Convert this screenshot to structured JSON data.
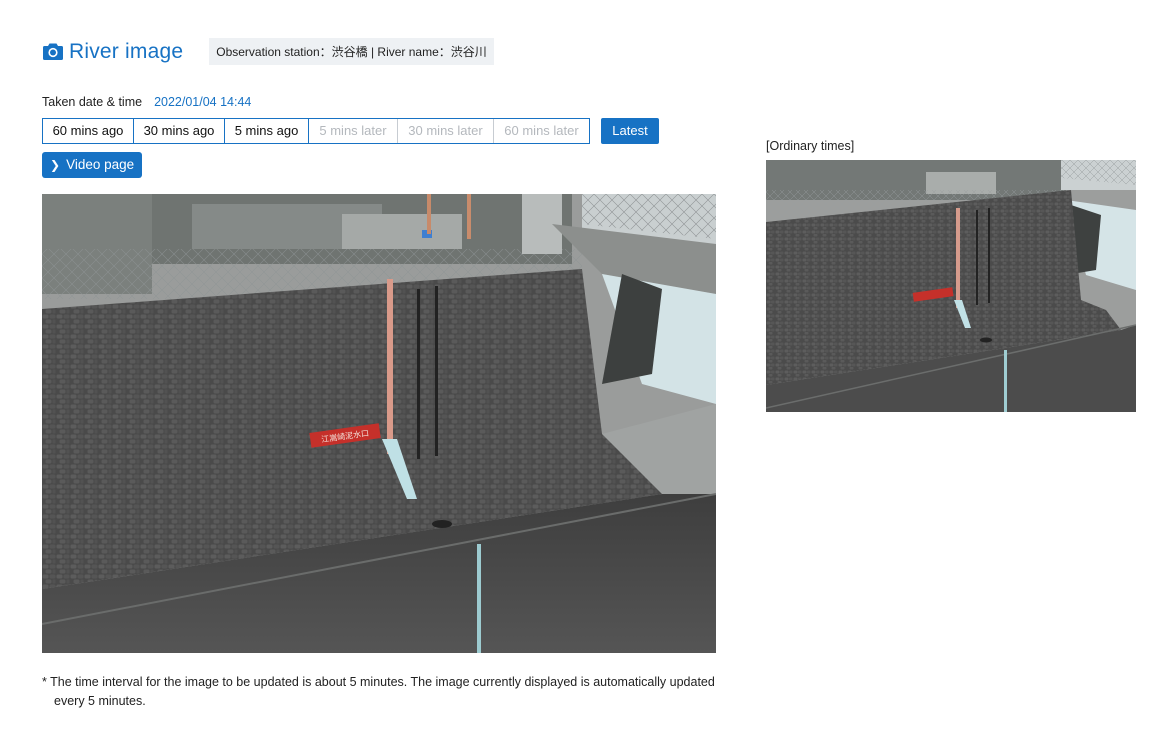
{
  "header": {
    "title": "River image",
    "title_icon": "camera-icon",
    "station_info": "Observation station：渋谷橋 | River name：渋谷川"
  },
  "taken": {
    "label": "Taken date & time",
    "value": "2022/01/04 14:44"
  },
  "time_nav": [
    {
      "label": "60 mins ago",
      "enabled": true
    },
    {
      "label": "30 mins ago",
      "enabled": true
    },
    {
      "label": "5 mins ago",
      "enabled": true
    },
    {
      "label": "5 mins later",
      "enabled": false
    },
    {
      "label": "30 mins later",
      "enabled": false
    },
    {
      "label": "60 mins later",
      "enabled": false
    }
  ],
  "latest_label": "Latest",
  "video_page_label": "Video page",
  "side": {
    "caption": "[Ordinary times]"
  },
  "camera_sign_text": "江嵩崎泥水口",
  "note": "* The time interval for the image to be updated is about 5 minutes. The image currently displayed is automatically updated every 5 minutes.",
  "colors": {
    "accent": "#1772c4",
    "disabled_text": "#b4b8bd",
    "station_bg": "#eef1f4"
  }
}
